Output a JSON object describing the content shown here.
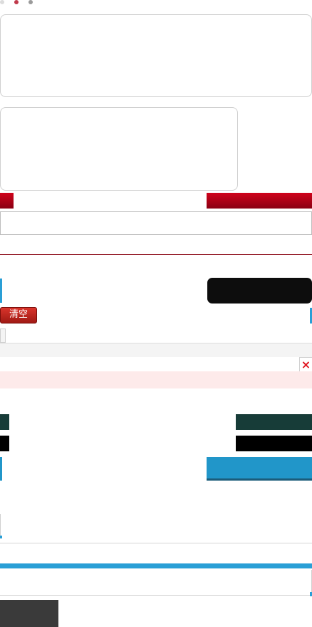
{
  "window": {
    "dots": [
      "#d9d9d9",
      "#c0394b",
      "#9a9a9a"
    ]
  },
  "colors": {
    "panel_border": "#cfcfcf",
    "brand_red": "#c0001a",
    "divider_red": "#8b0a18",
    "teal_dark": "#173c38",
    "black": "#0d0d0d",
    "accent_blue": "#2196c9",
    "error_bg": "#fdeaea",
    "error_x": "#e0141e",
    "dark_gray": "#3a3a3a"
  },
  "toolbar": {
    "clear_label": "清空"
  },
  "error": {
    "close_glyph": "×"
  }
}
